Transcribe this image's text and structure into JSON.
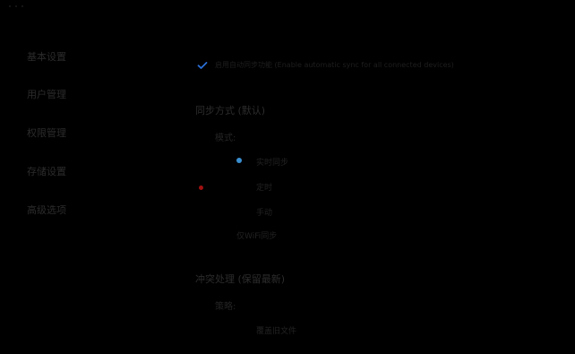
{
  "sidebar": {
    "items": [
      {
        "label": "基本设置"
      },
      {
        "label": "用户管理"
      },
      {
        "label": "权限管理"
      },
      {
        "label": "存储设置"
      },
      {
        "label": "高级选项"
      }
    ]
  },
  "main": {
    "top_option": {
      "label": "启用自动同步功能 (Enable automatic sync for all connected devices)",
      "checked": true
    },
    "sections": [
      {
        "title": "同步方式 (默认)",
        "sub_label": "模式:",
        "options": [
          {
            "label": "实时同步",
            "selected": true
          },
          {
            "label": "定时",
            "selected": false
          },
          {
            "label": "手动",
            "selected": false
          },
          {
            "label": "仅WiFi同步",
            "selected": false
          }
        ]
      },
      {
        "title": "冲突处理 (保留最新)",
        "sub_label": "策略:",
        "options": [
          {
            "label": "覆盖旧文件",
            "selected": false
          }
        ]
      }
    ]
  },
  "colors": {
    "background": "#000000",
    "accent_blue": "#2a6fd6",
    "radio_blue": "#3a8fd0",
    "marker_red": "#a01010",
    "text_dim": "#2a2a2a"
  },
  "icons": {
    "checkbox": "check-icon",
    "radio": "radio-dot-icon",
    "marker": "red-dot-icon"
  }
}
